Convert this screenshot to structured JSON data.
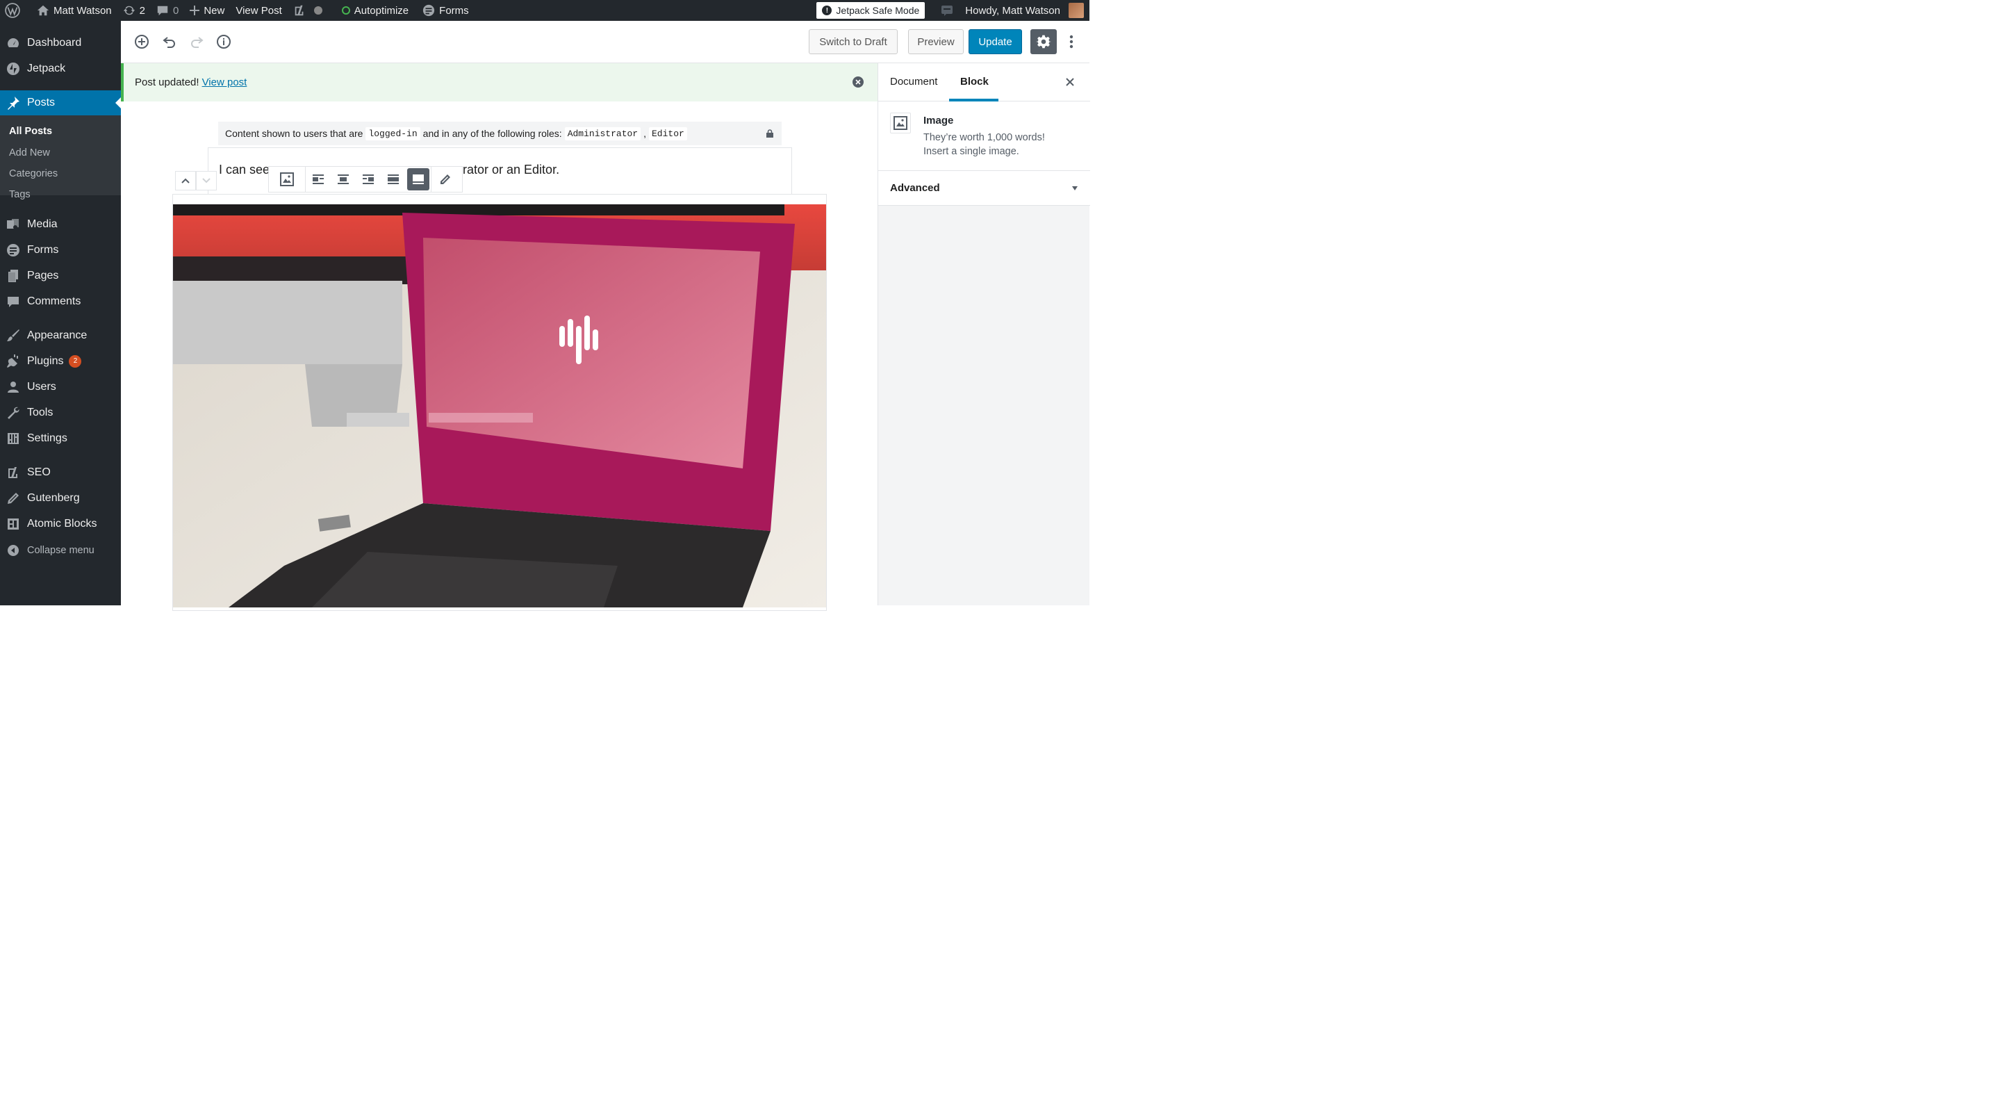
{
  "admin_bar": {
    "site_name": "Matt Watson",
    "updates_count": "2",
    "comments_count": "0",
    "new_label": "New",
    "view_post": "View Post",
    "autoptimize": "Autoptimize",
    "forms": "Forms",
    "safe_mode": "Jetpack Safe Mode",
    "howdy": "Howdy, Matt Watson"
  },
  "sidebar": {
    "dashboard": "Dashboard",
    "jetpack": "Jetpack",
    "posts": "Posts",
    "submenu": [
      "All Posts",
      "Add New",
      "Categories",
      "Tags"
    ],
    "media": "Media",
    "forms": "Forms",
    "pages": "Pages",
    "comments": "Comments",
    "appearance": "Appearance",
    "plugins": "Plugins",
    "plugins_badge": "2",
    "users": "Users",
    "tools": "Tools",
    "settings": "Settings",
    "seo": "SEO",
    "gutenberg": "Gutenberg",
    "atomic_blocks": "Atomic Blocks",
    "collapse": "Collapse menu"
  },
  "header": {
    "switch_to_draft": "Switch to Draft",
    "preview": "Preview",
    "update": "Update"
  },
  "notice": {
    "text": "Post updated!",
    "link": "View post"
  },
  "content": {
    "restriction_prefix": "Content shown to users that are",
    "restriction_status": "logged-in",
    "restriction_middle": "and in any of the following roles:",
    "role_1": "Administrator",
    "role_sep": ",",
    "role_2": "Editor",
    "para_start": "I can see",
    "para_end": "rator or an Editor."
  },
  "settings_panel": {
    "tab_document": "Document",
    "tab_block": "Block",
    "block_name": "Image",
    "block_desc_1": "They’re worth 1,000 words!",
    "block_desc_2": "Insert a single image.",
    "advanced": "Advanced"
  },
  "colors": {
    "admin_dark": "#23282d",
    "wp_blue": "#0073aa",
    "primary_button": "#0085ba",
    "notice_green": "#46b450",
    "badge_orange": "#d54e21"
  }
}
